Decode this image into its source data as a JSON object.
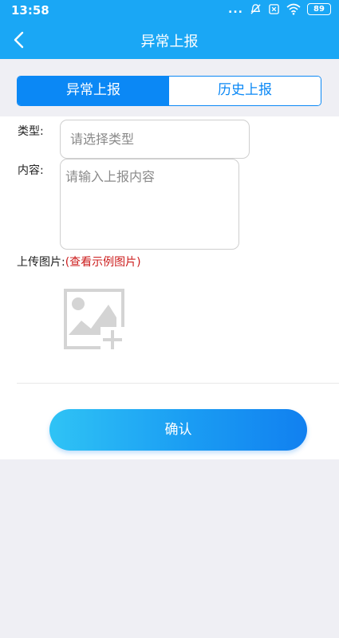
{
  "status_bar": {
    "time": "13:58",
    "dots": "...",
    "battery": "89",
    "icons": [
      "alarm-off-icon",
      "sim-card-off-icon",
      "wifi-icon",
      "battery-icon"
    ]
  },
  "nav": {
    "title": "异常上报",
    "back_icon": "chevron-left-icon"
  },
  "tabs": [
    {
      "label": "异常上报",
      "active": true
    },
    {
      "label": "历史上报",
      "active": false
    }
  ],
  "form": {
    "type_label": "类型:",
    "type_placeholder": "请选择类型",
    "content_label": "内容:",
    "content_placeholder": "请输入上报内容",
    "upload_label": "上传图片:",
    "example_link": "(查看示例图片)",
    "add_image_icon": "add-image-icon"
  },
  "confirm_label": "确认",
  "colors": {
    "header": "#1aa7f5",
    "tab_accent": "#0b88f5",
    "link_red": "#cc1d1d",
    "button_gradient": [
      "#2fc3f5",
      "#1180f0"
    ]
  }
}
